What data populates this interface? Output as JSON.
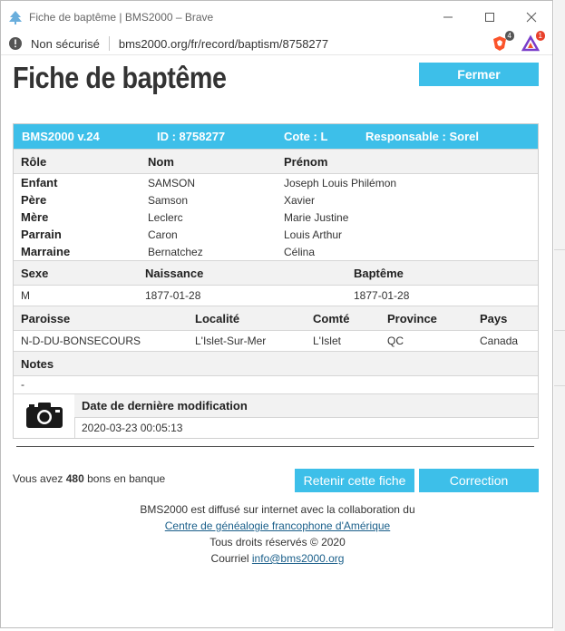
{
  "window": {
    "title": "Fiche de baptême | BMS2000 – Brave"
  },
  "addressbar": {
    "security": "Non sécurisé",
    "url": "bms2000.org/fr/record/baptism/8758277",
    "brave_count": "4",
    "rewards_count": "1"
  },
  "page": {
    "title": "Fiche de baptême",
    "close_label": "Fermer"
  },
  "card": {
    "version": "BMS2000 v.24",
    "id": "ID : 8758277",
    "cote": "Cote : L",
    "responsable": "Responsable : Sorel",
    "persons_headers": {
      "role": "Rôle",
      "nom": "Nom",
      "prenom": "Prénom"
    },
    "persons": [
      {
        "role": "Enfant",
        "nom": "SAMSON",
        "prenom": "Joseph Louis Philémon"
      },
      {
        "role": "Père",
        "nom": "Samson",
        "prenom": "Xavier"
      },
      {
        "role": "Mère",
        "nom": "Leclerc",
        "prenom": "Marie Justine"
      },
      {
        "role": "Parrain",
        "nom": "Caron",
        "prenom": "Louis Arthur"
      },
      {
        "role": "Marraine",
        "nom": "Bernatchez",
        "prenom": "Célina"
      }
    ],
    "event_headers": {
      "sexe": "Sexe",
      "naissance": "Naissance",
      "bapteme": "Baptême"
    },
    "event_values": {
      "sexe": "M",
      "naissance": "1877-01-28",
      "bapteme": "1877-01-28"
    },
    "place_headers": {
      "paroisse": "Paroisse",
      "localite": "Localité",
      "comte": "Comté",
      "province": "Province",
      "pays": "Pays"
    },
    "place_values": {
      "paroisse": "N-D-DU-BONSECOURS",
      "localite": "L'Islet-Sur-Mer",
      "comte": "L'Islet",
      "province": "QC",
      "pays": "Canada"
    },
    "notes_header": "Notes",
    "notes_value": "-",
    "modified_header": "Date de dernière modification",
    "modified_value": "2020-03-23 00:05:13"
  },
  "bank": {
    "prefix": "Vous avez",
    "amount": "480",
    "suffix": "bons en banque"
  },
  "actions": {
    "keep_label": "Retenir cette fiche",
    "correct_label": "Correction"
  },
  "footer": {
    "line1": "BMS2000 est diffusé sur internet avec la collaboration du",
    "link1": "Centre de généalogie francophone d'Amérique",
    "line3": "Tous droits réservés © 2020",
    "mail_prefix": "Courriel",
    "mail": "info@bms2000.org"
  },
  "colors": {
    "accent": "#3dbfe9",
    "header_bg": "#f2f2f2",
    "link": "#1a5f8a"
  },
  "icons": [
    "tree-icon",
    "minimize-icon",
    "maximize-icon",
    "close-icon",
    "warning-icon",
    "brave-shield-icon",
    "brave-rewards-icon",
    "camera-icon"
  ]
}
